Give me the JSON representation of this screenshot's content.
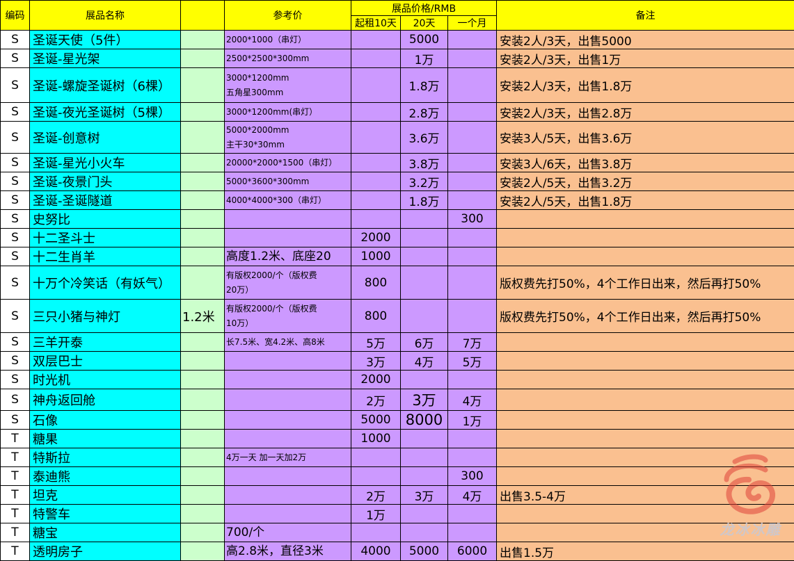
{
  "header": {
    "code": "编码",
    "name": "展品名称",
    "ref_price": "参考价",
    "price_group": "展品价格/RMB",
    "p10": "起租10天",
    "p20": "20天",
    "p30": "一个月",
    "note": "备注"
  },
  "rows": [
    {
      "code": "S",
      "name": "圣诞天使（5件）",
      "spec": "",
      "ref": "2000*1000（串灯）",
      "p10": "",
      "p20": "5000",
      "p30": "",
      "note": "安装2人/3天，出售5000"
    },
    {
      "code": "S",
      "name": "圣诞-星光架",
      "spec": "",
      "ref": "2500*2500*300mm",
      "p10": "",
      "p20": "1万",
      "p30": "",
      "note": "安装2人/3天，出售1万"
    },
    {
      "code": "S",
      "name": "圣诞-螺旋圣诞树（6棵）",
      "spec": "",
      "ref": "3000*1200mm\n五角星300mm",
      "p10": "",
      "p20": "1.8万",
      "p30": "",
      "note": "安装2人/3天，出售1.8万"
    },
    {
      "code": "S",
      "name": "圣诞-夜光圣诞树（5棵）",
      "spec": "",
      "ref": "3000*1200mm(串灯）",
      "p10": "",
      "p20": "2.8万",
      "p30": "",
      "note": "安装2人/3天，出售2.8万"
    },
    {
      "code": "S",
      "name": "圣诞-创意树",
      "spec": "",
      "ref": "5000*2000mm\n主干30*30mm",
      "p10": "",
      "p20": "3.6万",
      "p30": "",
      "note": "安装3人/5天，出售3.6万"
    },
    {
      "code": "S",
      "name": "圣诞-星光小火车",
      "spec": "",
      "ref": "20000*2000*1500（串灯）",
      "p10": "",
      "p20": "3.8万",
      "p30": "",
      "note": "安装3人/6天，出售3.8万"
    },
    {
      "code": "S",
      "name": "圣诞-夜景门头",
      "spec": "",
      "ref": "5000*3600*300mm",
      "p10": "",
      "p20": "3.2万",
      "p30": "",
      "note": "安装2人/5天，出售3.2万"
    },
    {
      "code": "S",
      "name": "圣诞-圣诞隧道",
      "spec": "",
      "ref": "4000*4000*300（串灯）",
      "p10": "",
      "p20": "1.8万",
      "p30": "",
      "note": "安装2人/5天，出售1.8万"
    },
    {
      "code": "S",
      "name": "史努比",
      "spec": "",
      "ref": "",
      "p10": "",
      "p20": "",
      "p30": "300",
      "note": ""
    },
    {
      "code": "S",
      "name": "十二圣斗士",
      "spec": "",
      "ref": "",
      "p10": "2000",
      "p20": "",
      "p30": "",
      "note": ""
    },
    {
      "code": "S",
      "name": "十二生肖羊",
      "spec": "",
      "ref": "高度1.2米、底座20",
      "p10": "1000",
      "p20": "",
      "p30": "",
      "note": ""
    },
    {
      "code": "S",
      "name": "十万个冷笑话（有妖气）",
      "spec": "",
      "ref": "有版权2000/个（版权费\n20万）",
      "p10": "800",
      "p20": "",
      "p30": "",
      "note": "版权费先打50%，4个工作日出来，然后再打50%"
    },
    {
      "code": "S",
      "name": "三只小猪与神灯",
      "spec": "1.2米",
      "ref": "有版权2000/个（版权费\n10万）",
      "p10": "800",
      "p20": "",
      "p30": "",
      "note": "版权费先打50%，4个工作日出来，然后再打50%"
    },
    {
      "code": "S",
      "name": "三羊开泰",
      "spec": "",
      "ref": "长7.5米、宽4.2米、高8米",
      "p10": "5万",
      "p20": "6万",
      "p30": "7万",
      "note": ""
    },
    {
      "code": "S",
      "name": "双层巴士",
      "spec": "",
      "ref": "",
      "p10": "3万",
      "p20": "4万",
      "p30": "5万",
      "note": ""
    },
    {
      "code": "S",
      "name": "时光机",
      "spec": "",
      "ref": "",
      "p10": "2000",
      "p20": "",
      "p30": "",
      "note": ""
    },
    {
      "code": "S",
      "name": "神舟返回舱",
      "spec": "",
      "ref": "",
      "p10": "2万",
      "p20": "3万",
      "p30": "4万",
      "note": ""
    },
    {
      "code": "S",
      "name": "石像",
      "spec": "",
      "ref": "",
      "p10": "5000",
      "p20": "8000",
      "p30": "1万",
      "note": ""
    },
    {
      "code": "T",
      "name": "糖果",
      "spec": "",
      "ref": "",
      "p10": "1000",
      "p20": "",
      "p30": "",
      "note": ""
    },
    {
      "code": "T",
      "name": "特斯拉",
      "spec": "",
      "ref": "4万一天 加一天加2万",
      "p10": "",
      "p20": "",
      "p30": "",
      "note": ""
    },
    {
      "code": "T",
      "name": "泰迪熊",
      "spec": "",
      "ref": "",
      "p10": "",
      "p20": "",
      "p30": "300",
      "note": ""
    },
    {
      "code": "T",
      "name": "坦克",
      "spec": "",
      "ref": "",
      "p10": "2万",
      "p20": "3万",
      "p30": "4万",
      "note": "出售3.5-4万"
    },
    {
      "code": "T",
      "name": "特警车",
      "spec": "",
      "ref": "",
      "p10": "1万",
      "p20": "",
      "p30": "",
      "note": ""
    },
    {
      "code": "T",
      "name": "糖宝",
      "spec": "",
      "ref": "700/个",
      "p10": "",
      "p20": "",
      "p30": "",
      "note": ""
    },
    {
      "code": "T",
      "name": "透明房子",
      "spec": "",
      "ref": "高2.8米，直径3米",
      "p10": "4000",
      "p20": "5000",
      "p30": "6000",
      "note": "出售1.5万"
    }
  ],
  "watermark": {
    "text": "龙冰冰雕",
    "color": "#e0443a"
  }
}
